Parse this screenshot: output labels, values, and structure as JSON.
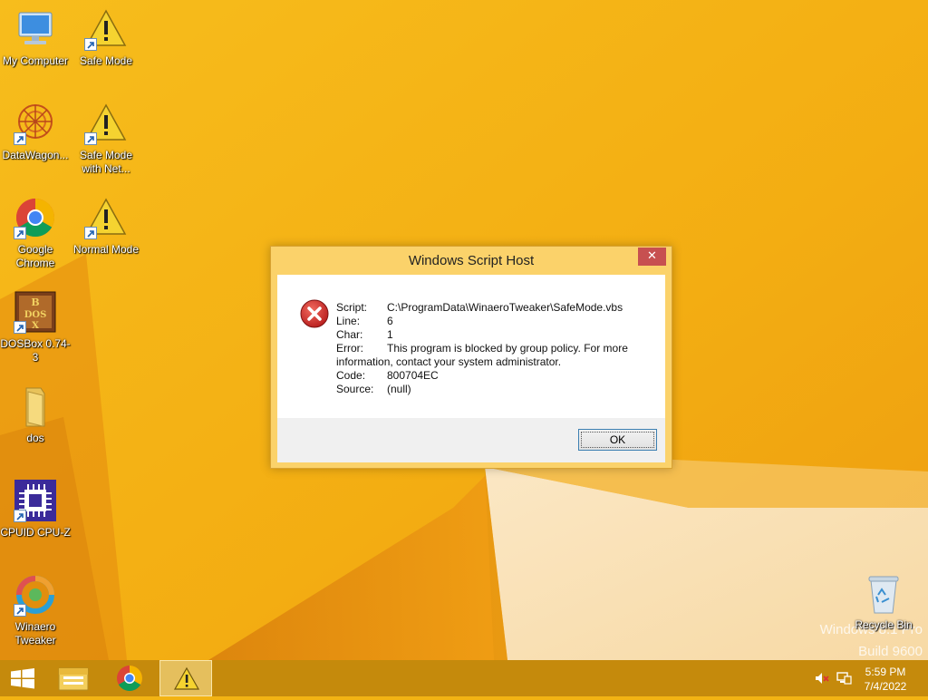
{
  "desktop": {
    "icons": [
      {
        "label": "My Computer"
      },
      {
        "label": "Safe Mode"
      },
      {
        "label": "DataWagon..."
      },
      {
        "label": "Safe Mode with Net..."
      },
      {
        "label": "Google Chrome"
      },
      {
        "label": "Normal Mode"
      },
      {
        "label": "DOSBox 0.74-3"
      },
      {
        "label": "dos"
      },
      {
        "label": "CPUID CPU-Z"
      },
      {
        "label": "Winaero Tweaker"
      },
      {
        "label": "Recycle Bin"
      }
    ],
    "watermark_line1": "Windows 8.1 Pro",
    "watermark_line2": "Build 9600"
  },
  "dialog": {
    "title": "Windows Script Host",
    "close_glyph": "✕",
    "icon": "error-icon",
    "rows": [
      {
        "key": "Script:",
        "value": "C:\\ProgramData\\WinaeroTweaker\\SafeMode.vbs"
      },
      {
        "key": "Line:",
        "value": "6"
      },
      {
        "key": "Char:",
        "value": "1"
      },
      {
        "key": "Error:",
        "value": "This program is blocked by group policy. For more"
      },
      {
        "key": "Code:",
        "value": "800704EC"
      },
      {
        "key": "Source:",
        "value": "(null)"
      }
    ],
    "error_continuation": "information, contact your system administrator.",
    "ok_label": "OK"
  },
  "taskbar": {
    "items": [
      "start-button",
      "file-explorer",
      "google-chrome",
      "windows-script-host"
    ],
    "clock_time": "5:59 PM",
    "clock_date": "7/4/2022"
  },
  "colors": {
    "wallpaper": "#f3b313",
    "taskbar": "#c58a0c",
    "dialog_frame": "#fbd26a",
    "close_button": "#c75050"
  }
}
